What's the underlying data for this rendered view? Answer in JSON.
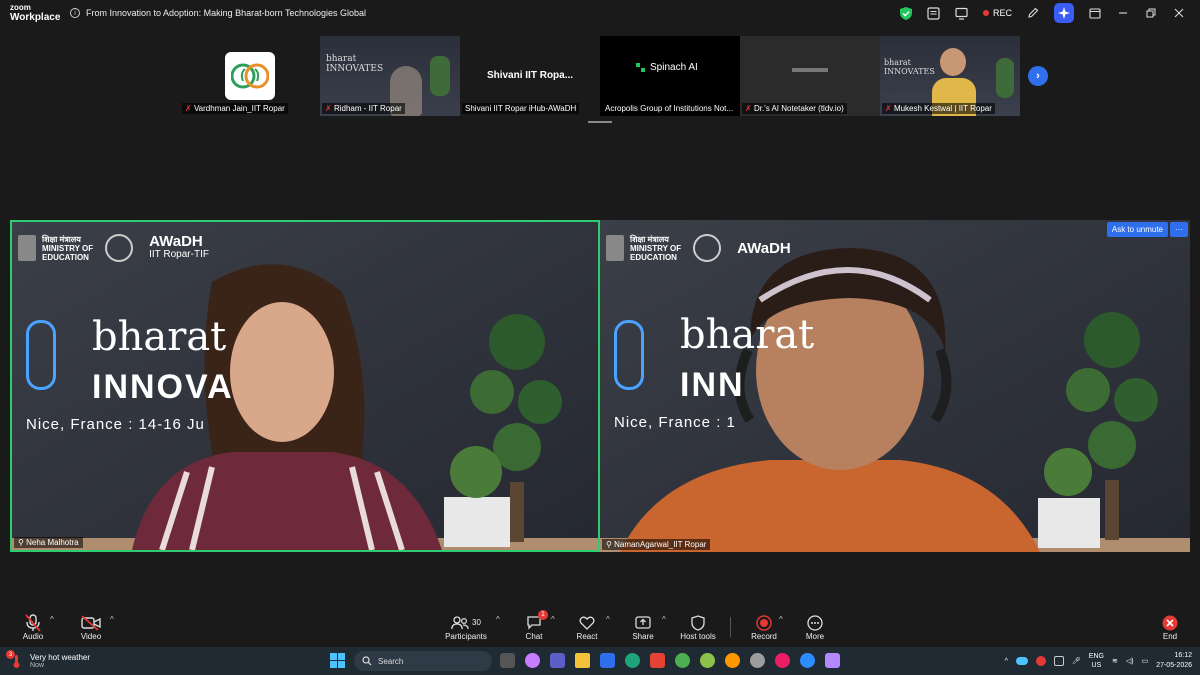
{
  "titlebar": {
    "logo_line1": "zoom",
    "logo_line2": "Workplace",
    "meeting_title": "From Innovation to Adoption: Making Bharat-born Technologies Global",
    "rec_label": "REC"
  },
  "thumbnails": [
    {
      "name": "Vardhman Jain_IIT Ropar"
    },
    {
      "name": "Ridham - IIT Ropar"
    },
    {
      "name": "Shivani IIT Ropar iHub-AWaDH",
      "display": "Shivani IIT Ropa..."
    },
    {
      "name": "Acropolis Group of Institutions Not...",
      "logo_text": "Spinach AI"
    },
    {
      "name": "Dr.'s AI Notetaker (tldv.io)"
    },
    {
      "name": "Mukesh Kestwal | IIT Ropar"
    }
  ],
  "slide": {
    "ministry_line1": "शिक्षा मंत्रालय",
    "ministry_line2": "MINISTRY OF",
    "ministry_line3": "EDUCATION",
    "awadh": "AWaDH",
    "awadh_sub": "IIT Ropar-TIF",
    "bharat": "bharat",
    "innovates_left": "INNOVA",
    "innovates_right": "INN",
    "location_left": "Nice, France : 14-16 Ju",
    "location_right": "Nice, France : 1"
  },
  "main_tiles": {
    "left_name": "Neha Malhotra",
    "right_name": "NamanAgarwal_IIT Ropar",
    "ask_unmute": "Ask to unmute",
    "more_dots": "···"
  },
  "toolbar": {
    "audio": "Audio",
    "video": "Video",
    "participants": "Participants",
    "participants_count": "30",
    "chat": "Chat",
    "chat_badge": "1",
    "react": "React",
    "share": "Share",
    "host_tools": "Host tools",
    "record": "Record",
    "more": "More",
    "end": "End"
  },
  "taskbar": {
    "weather_badge": "3",
    "weather_title": "Very hot weather",
    "weather_sub": "Now",
    "search_placeholder": "Search",
    "lang_line1": "ENG",
    "lang_line2": "US",
    "time": "16:12",
    "date": "27-05-2026"
  },
  "colors": {
    "active_border": "#2ecc71",
    "accent_blue": "#2f6fed",
    "record_red": "#e53935"
  }
}
